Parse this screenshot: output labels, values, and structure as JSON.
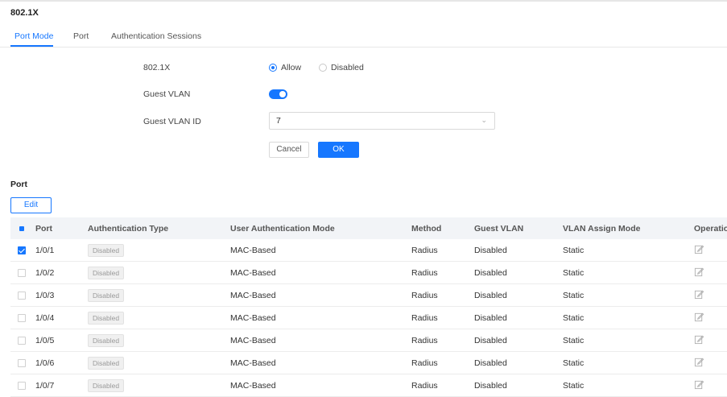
{
  "page": {
    "title": "802.1X"
  },
  "tabs": [
    {
      "label": "Port Mode",
      "active": true
    },
    {
      "label": "Port",
      "active": false
    },
    {
      "label": "Authentication Sessions",
      "active": false
    }
  ],
  "form": {
    "dot1x_label": "802.1X",
    "allow_label": "Allow",
    "disabled_label": "Disabled",
    "selected": "Allow",
    "guest_vlan_label": "Guest VLAN",
    "guest_vlan_enabled": true,
    "guest_vlan_id_label": "Guest VLAN ID",
    "guest_vlan_id_value": "7",
    "cancel_label": "Cancel",
    "ok_label": "OK"
  },
  "port_section": {
    "label": "Port",
    "edit_label": "Edit"
  },
  "table": {
    "headers": [
      "Port",
      "Authentication Type",
      "User Authentication Mode",
      "Method",
      "Guest VLAN",
      "VLAN Assign Mode",
      "Operation"
    ],
    "rows": [
      {
        "checked": true,
        "port": "1/0/1",
        "auth_type": "Disabled",
        "user_auth_mode": "MAC-Based",
        "method": "Radius",
        "guest_vlan": "Disabled",
        "vlan_assign_mode": "Static"
      },
      {
        "checked": false,
        "port": "1/0/2",
        "auth_type": "Disabled",
        "user_auth_mode": "MAC-Based",
        "method": "Radius",
        "guest_vlan": "Disabled",
        "vlan_assign_mode": "Static"
      },
      {
        "checked": false,
        "port": "1/0/3",
        "auth_type": "Disabled",
        "user_auth_mode": "MAC-Based",
        "method": "Radius",
        "guest_vlan": "Disabled",
        "vlan_assign_mode": "Static"
      },
      {
        "checked": false,
        "port": "1/0/4",
        "auth_type": "Disabled",
        "user_auth_mode": "MAC-Based",
        "method": "Radius",
        "guest_vlan": "Disabled",
        "vlan_assign_mode": "Static"
      },
      {
        "checked": false,
        "port": "1/0/5",
        "auth_type": "Disabled",
        "user_auth_mode": "MAC-Based",
        "method": "Radius",
        "guest_vlan": "Disabled",
        "vlan_assign_mode": "Static"
      },
      {
        "checked": false,
        "port": "1/0/6",
        "auth_type": "Disabled",
        "user_auth_mode": "MAC-Based",
        "method": "Radius",
        "guest_vlan": "Disabled",
        "vlan_assign_mode": "Static"
      },
      {
        "checked": false,
        "port": "1/0/7",
        "auth_type": "Disabled",
        "user_auth_mode": "MAC-Based",
        "method": "Radius",
        "guest_vlan": "Disabled",
        "vlan_assign_mode": "Static"
      }
    ]
  },
  "colors": {
    "accent": "#1677ff",
    "header_bg": "#f2f4f7"
  },
  "icons": {
    "operation": "edit-icon"
  }
}
